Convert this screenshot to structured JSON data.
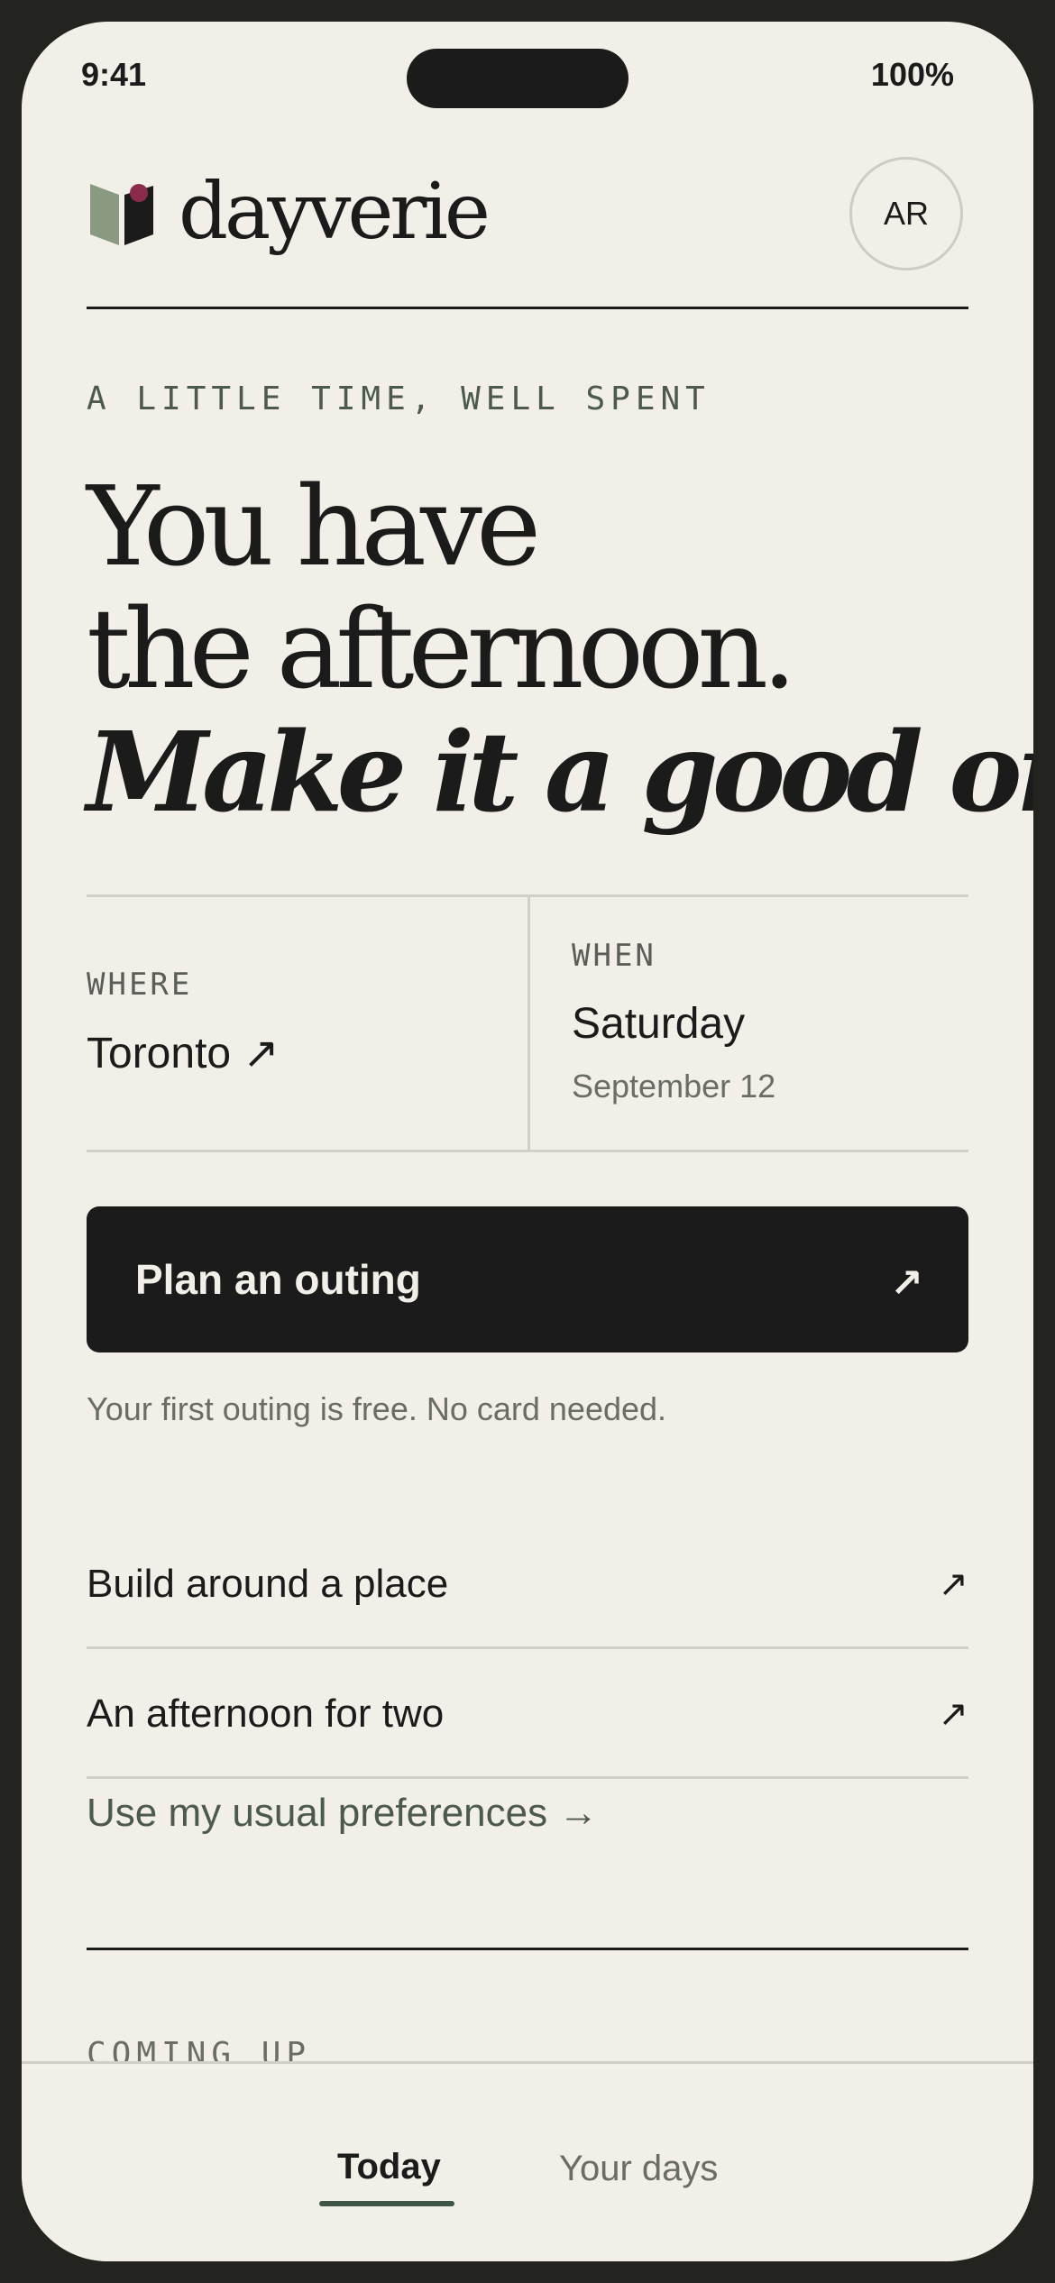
{
  "status_bar": {
    "time": "9:41",
    "battery": "100%"
  },
  "header": {
    "logo_text": "dayverie",
    "avatar_initials": "AR"
  },
  "hero": {
    "eyebrow": "A LITTLE TIME, WELL SPENT",
    "line1": "You have",
    "line2": "the afternoon.",
    "line3": "Make it a good one."
  },
  "where": {
    "label": "WHERE",
    "value": "Toronto ↗"
  },
  "when": {
    "label": "WHEN",
    "day": "Saturday",
    "date": "September 12"
  },
  "cta": {
    "label": "Plan an outing",
    "arrow": "↗"
  },
  "note": "Your first outing is free. No card needed.",
  "options": [
    {
      "label": "Build around a place",
      "arrow": "↗"
    },
    {
      "label": "An afternoon for two",
      "arrow": "↗"
    }
  ],
  "preferences_link": "Use my usual preferences →",
  "section_title": "COMING UP",
  "tabs": {
    "today": "Today",
    "your_days": "Your days"
  },
  "colors": {
    "background": "#f1efe7",
    "ink": "#1b1b1b",
    "accent_green": "#3f5544",
    "logo_green": "#8a9a82",
    "logo_berry": "#8b2a4a"
  }
}
